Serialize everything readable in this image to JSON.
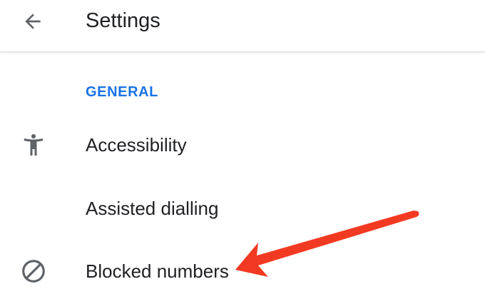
{
  "header": {
    "title": "Settings",
    "back_icon": "arrow-back-icon"
  },
  "section": {
    "label": "GENERAL",
    "color": "#1a73e8"
  },
  "items": [
    {
      "label": "Accessibility",
      "icon": "accessibility-icon"
    },
    {
      "label": "Assisted dialling",
      "icon": null
    },
    {
      "label": "Blocked numbers",
      "icon": "block-icon"
    }
  ],
  "annotation": {
    "arrow_color": "#f23a22",
    "points_to": "Blocked numbers"
  }
}
